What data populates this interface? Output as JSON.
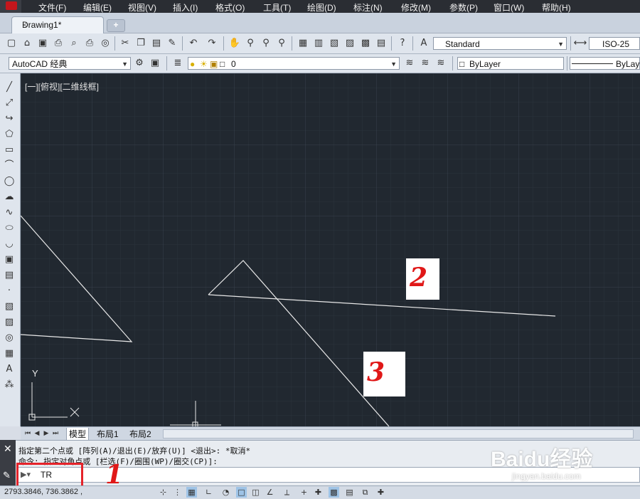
{
  "menubar": {
    "items": [
      "文件(F)",
      "编辑(E)",
      "视图(V)",
      "插入(I)",
      "格式(O)",
      "工具(T)",
      "绘图(D)",
      "标注(N)",
      "修改(M)",
      "参数(P)",
      "窗口(W)",
      "帮助(H)"
    ]
  },
  "document_tab": {
    "title": "Drawing1*",
    "close_glyph": "×",
    "new_tab_glyph": "+"
  },
  "toolbar1": {
    "icons": [
      "new-icon",
      "open-icon",
      "save-icon",
      "print-icon",
      "print-preview-icon",
      "plot-icon",
      "publish-icon",
      "cut-icon",
      "copy-icon",
      "paste-icon",
      "match-properties-icon",
      "undo-icon",
      "redo-icon",
      "pan-icon",
      "zoom-realtime-icon",
      "zoom-window-icon",
      "zoom-previous-icon",
      "properties-icon",
      "design-center-icon",
      "tool-palettes-icon",
      "sheet-set-icon",
      "markup-icon",
      "calculator-icon",
      "help-icon"
    ],
    "text_style": "Standard",
    "dim_style": "ISO-25"
  },
  "toolbar2": {
    "workspace": "AutoCAD 经典",
    "layer": "0",
    "color": "ByLayer",
    "linetype": "ByLaye"
  },
  "palette": {
    "icons": [
      "line-icon",
      "construction-line-icon",
      "polyline-icon",
      "polygon-icon",
      "rectangle-icon",
      "arc-icon",
      "circle-icon",
      "revision-cloud-icon",
      "spline-icon",
      "ellipse-icon",
      "ellipse-arc-icon",
      "insert-block-icon",
      "make-block-icon",
      "point-icon",
      "hatch-icon",
      "gradient-icon",
      "region-icon",
      "table-icon",
      "multiline-text-icon",
      "add-selected-icon"
    ]
  },
  "canvas": {
    "viewport_label": "[一][俯视][二维线框]",
    "ucs_y": "Y",
    "ucs_x": "X"
  },
  "layout_tabs": {
    "model": "模型",
    "layout1": "布局1",
    "layout2": "布局2"
  },
  "command": {
    "line1": "指定第二个点或 [阵列(A)/退出(E)/放弃(U)] <退出>: *取消*",
    "line2": "命令: 指定对角点或 [栏选(F)/圈围(WP)/圈交(CP)]:",
    "input": "TR"
  },
  "status": {
    "coords": "2793.3846, 736.3862 ,"
  },
  "annotations": {
    "n1": "1",
    "n2": "2",
    "n3": "3"
  },
  "watermark": {
    "brand": "Baidu经验",
    "url": "jingyan.baidu.com"
  },
  "colors": {
    "canvas_bg": "#212830",
    "annotation_red": "#e01818"
  }
}
